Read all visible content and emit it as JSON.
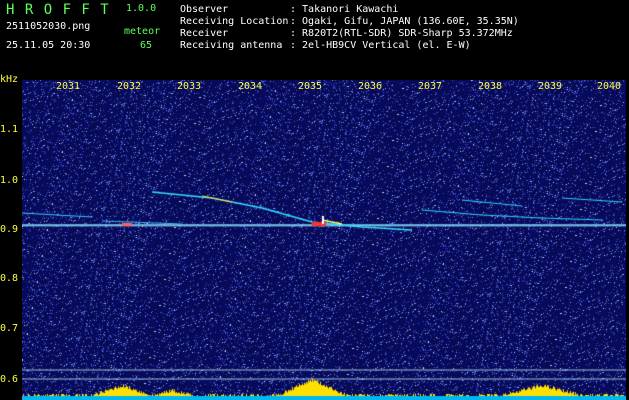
{
  "header": {
    "app_name": "H R O F F T",
    "version": "1.0.0",
    "filename": "2511052030.png",
    "datetime": "25.11.05 20:30",
    "count_label": "meteor",
    "count_value": "65"
  },
  "info": [
    {
      "label": "Observer",
      "value": ": Takanori Kawachi"
    },
    {
      "label": "Receiving Location",
      "value": ": Ogaki, Gifu, JAPAN (136.60E, 35.35N)"
    },
    {
      "label": "Receiver",
      "value": ": R820T2(RTL-SDR) SDR-Sharp 53.372MHz"
    },
    {
      "label": "Receiving antenna",
      "value": ": 2el-HB9CV Vertical (el. E-W)"
    }
  ],
  "axes": {
    "y_unit": "kHz",
    "y_ticks": [
      "1.1",
      "1.0",
      "0.9",
      "0.8",
      "0.7",
      "0.6"
    ],
    "x_ticks": [
      "2031",
      "2032",
      "2033",
      "2034",
      "2035",
      "2036",
      "2037",
      "2038",
      "2039",
      "2040"
    ]
  },
  "colors": {
    "background": "#000000",
    "noise_base": "#0a0a5a",
    "label_green": "#5cff5c",
    "tick_yellow": "#ffff40",
    "signal_cyan": "#40e0ff",
    "peak_red": "#ff3030",
    "level_bar_cyan": "#00c8ff",
    "level_bar_yellow": "#ffe000"
  }
}
